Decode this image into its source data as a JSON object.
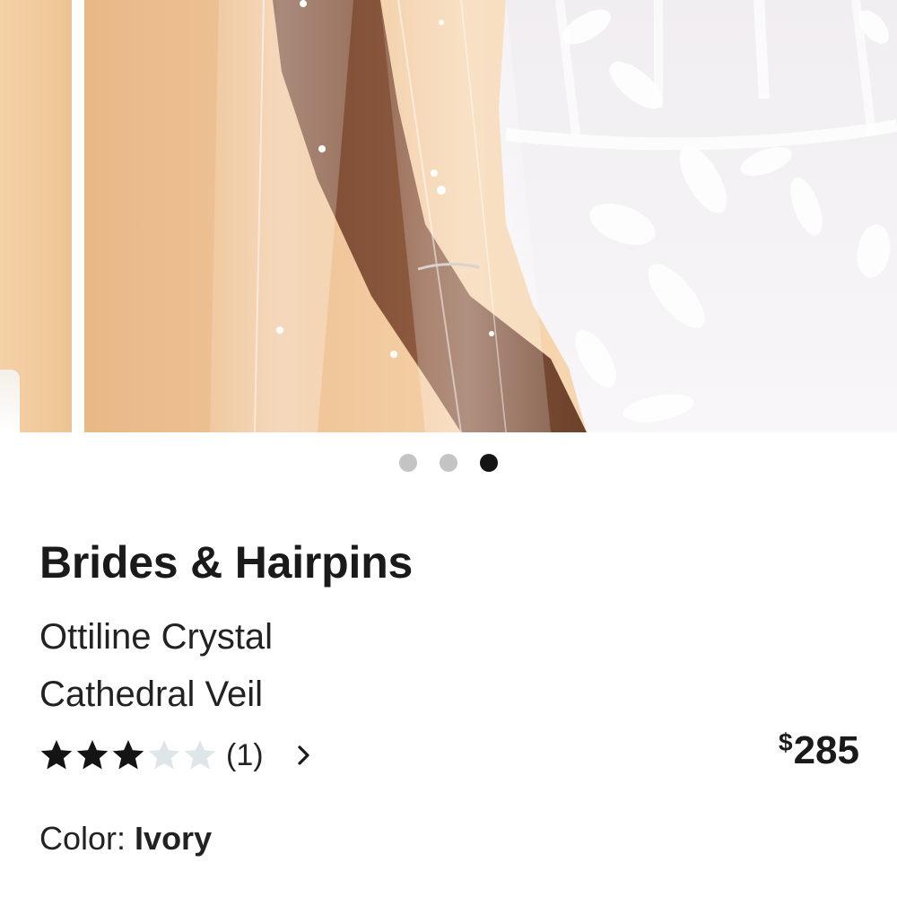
{
  "carousel": {
    "dots_total": 3,
    "active_index": 2
  },
  "product": {
    "brand": "Brides & Hairpins",
    "name_line1": "Ottiline Crystal",
    "name_line2": "Cathedral Veil",
    "rating": 3,
    "rating_max": 5,
    "review_count": "(1)",
    "price_currency": "$",
    "price_amount": "285",
    "color_label": "Color:",
    "color_value": "Ivory"
  },
  "colors": {
    "star_filled": "#141414",
    "star_empty": "#dfe6ea",
    "dot_inactive": "#c4c4c4",
    "dot_active": "#141414"
  },
  "icons": {
    "star": "star-icon",
    "chevron": "chevron-right-icon"
  }
}
